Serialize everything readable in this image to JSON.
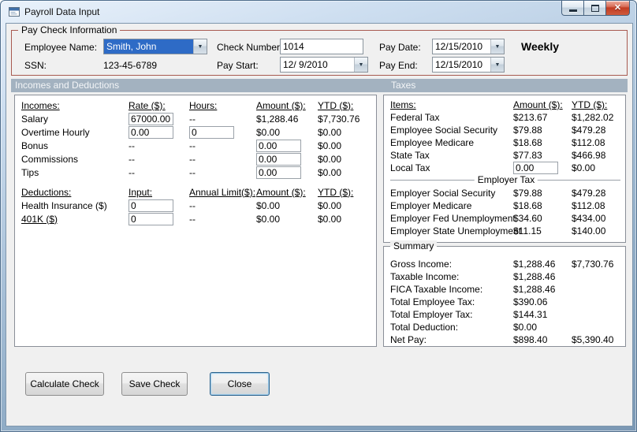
{
  "window": {
    "title": "Payroll Data Input"
  },
  "icons": {
    "dropdown_arrow": "▼",
    "close_glyph": "✕"
  },
  "paycheck": {
    "group_label": "Pay Check Information",
    "employee_name": {
      "label": "Employee Name:",
      "value": "Smith, John"
    },
    "ssn": {
      "label": "SSN:",
      "value": "123-45-6789"
    },
    "check_number": {
      "label": "Check Number:",
      "value": "1014"
    },
    "pay_start": {
      "label": "Pay Start:",
      "value": "12/ 9/2010"
    },
    "pay_date": {
      "label": "Pay Date:",
      "value": "12/15/2010"
    },
    "pay_end": {
      "label": "Pay End:",
      "value": "12/15/2010"
    },
    "frequency": "Weekly"
  },
  "sections": {
    "left": "Incomes and Deductions",
    "right": "Taxes"
  },
  "incomes": {
    "headers": {
      "name": "Incomes:",
      "rate": "Rate ($):",
      "hours": "Hours:",
      "amount": "Amount ($):",
      "ytd": "YTD ($):"
    },
    "salary": {
      "label": "Salary",
      "rate_input": "67000.00",
      "hours": "--",
      "amount": "$1,288.46",
      "ytd": "$7,730.76"
    },
    "overtime": {
      "label": "Overtime Hourly",
      "rate_input": "0.00",
      "hours_input": "0",
      "amount": "$0.00",
      "ytd": "$0.00"
    },
    "bonus": {
      "label": "Bonus",
      "rate": "--",
      "hours": "--",
      "amount_input": "0.00",
      "ytd": "$0.00"
    },
    "commissions": {
      "label": "Commissions",
      "rate": "--",
      "hours": "--",
      "amount_input": "0.00",
      "ytd": "$0.00"
    },
    "tips": {
      "label": "Tips",
      "rate": "--",
      "hours": "--",
      "amount_input": "0.00",
      "ytd": "$0.00"
    }
  },
  "deductions": {
    "headers": {
      "name": "Deductions:",
      "input": "Input:",
      "limit": "Annual Limit($):",
      "amount": "Amount ($):",
      "ytd": "YTD ($):"
    },
    "health_insurance": {
      "label": "Health Insurance  ($)",
      "input": "0",
      "limit": "--",
      "amount": "$0.00",
      "ytd": "$0.00"
    },
    "k401": {
      "label": "401K  ($)",
      "input": "0",
      "limit": "--",
      "amount": "$0.00",
      "ytd": "$0.00"
    }
  },
  "taxes": {
    "headers": {
      "items": "Items:",
      "amount": "Amount ($):",
      "ytd": "YTD ($):"
    },
    "employee_rows": [
      {
        "label": "Federal Tax",
        "amount": "$213.67",
        "ytd": "$1,282.02"
      },
      {
        "label": "Employee Social Security",
        "amount": "$79.88",
        "ytd": "$479.28"
      },
      {
        "label": "Employee Medicare",
        "amount": "$18.68",
        "ytd": "$112.08"
      },
      {
        "label": "State Tax",
        "amount": "$77.83",
        "ytd": "$466.98"
      }
    ],
    "local_tax": {
      "label": "Local Tax",
      "amount_input": "0.00",
      "ytd": "$0.00"
    },
    "employer_group_label": "Employer Tax",
    "employer_rows": [
      {
        "label": "Employer Social Security",
        "amount": "$79.88",
        "ytd": "$479.28"
      },
      {
        "label": "Employer Medicare",
        "amount": "$18.68",
        "ytd": "$112.08"
      },
      {
        "label": "Employer Fed Unemployment",
        "amount": "$34.60",
        "ytd": "$434.00"
      },
      {
        "label": "Employer State Unemployment",
        "amount": "$11.15",
        "ytd": "$140.00"
      }
    ]
  },
  "summary": {
    "group_label": "Summary",
    "rows": [
      {
        "label": "Gross Income:",
        "amount": "$1,288.46",
        "ytd": "$7,730.76"
      },
      {
        "label": "Taxable Income:",
        "amount": "$1,288.46",
        "ytd": ""
      },
      {
        "label": "FICA Taxable Income:",
        "amount": "$1,288.46",
        "ytd": ""
      },
      {
        "label": "Total Employee Tax:",
        "amount": "$390.06",
        "ytd": ""
      },
      {
        "label": "Total Employer Tax:",
        "amount": "$144.31",
        "ytd": ""
      },
      {
        "label": "Total Deduction:",
        "amount": "$0.00",
        "ytd": ""
      },
      {
        "label": "Net Pay:",
        "amount": "$898.40",
        "ytd": "$5,390.40"
      }
    ]
  },
  "buttons": {
    "calculate": "Calculate Check",
    "save": "Save Check",
    "close": "Close"
  },
  "colors": {
    "selection": "#2e6bc6",
    "section_band": "#a3b2c0",
    "group_border": "#a85a50",
    "close_button": "#c13c22"
  }
}
